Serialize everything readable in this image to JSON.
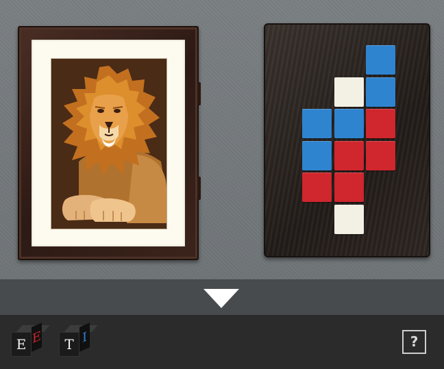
{
  "scene": {
    "picture": {
      "subject": "lion"
    },
    "puzzle_board": {
      "colors": {
        "blue": "#2f84cf",
        "red": "#d0262e",
        "white": "#f3f0e4"
      },
      "grid": [
        [
          null,
          null,
          "blue"
        ],
        [
          null,
          "white",
          "blue"
        ],
        [
          "blue",
          "blue",
          "red"
        ],
        [
          "blue",
          "red",
          "red"
        ],
        [
          "red",
          "red",
          null
        ],
        [
          null,
          "white",
          null
        ]
      ]
    }
  },
  "arrow_bar": {
    "icon": "chevron-down-icon"
  },
  "toolbar": {
    "cubes": [
      {
        "front_letter": "E",
        "side_letter": "E",
        "side_color": "#d0262e"
      },
      {
        "front_letter": "T",
        "side_letter": "I",
        "side_color": "#2f84cf"
      }
    ],
    "help_label": "?"
  }
}
